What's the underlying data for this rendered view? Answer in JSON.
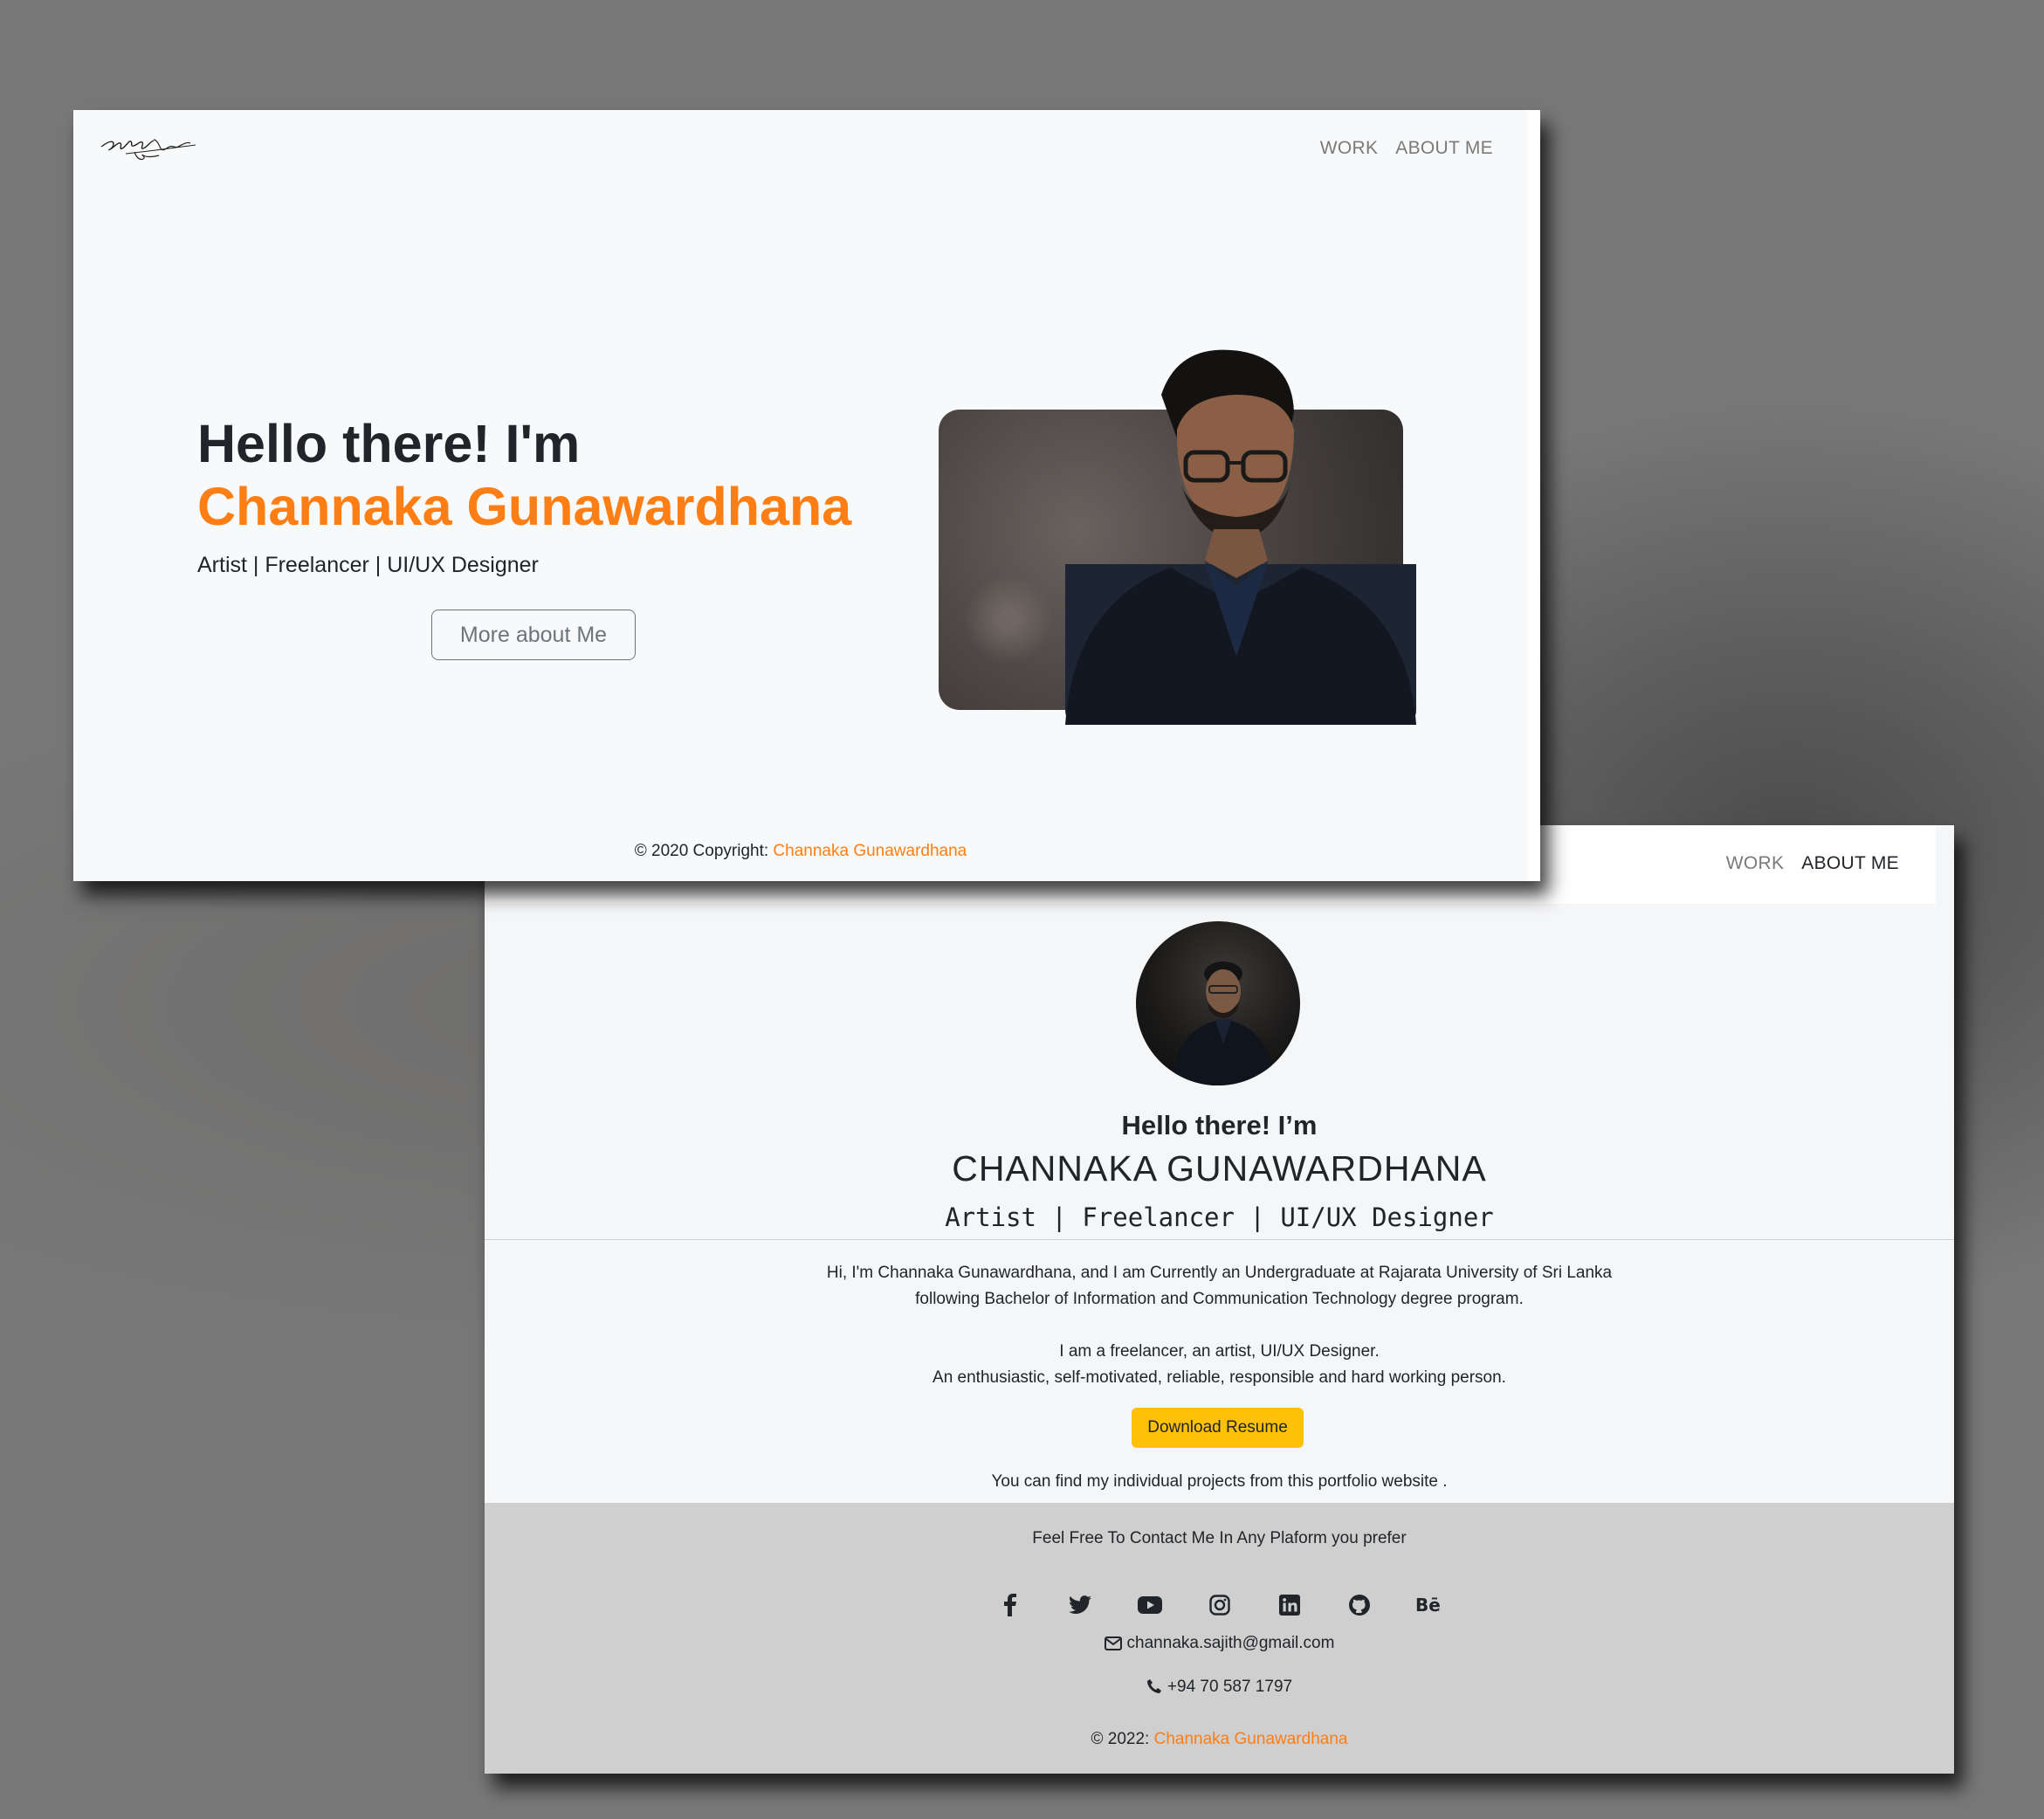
{
  "home": {
    "nav": {
      "items": [
        "WORK",
        "ABOUT ME"
      ]
    },
    "hero": {
      "greeting": "Hello there! I'm",
      "name": "Channaka Gunawardhana",
      "roles": "Artist | Freelancer | UI/UX Designer",
      "button": "More about Me"
    },
    "footer": {
      "prefix": "© 2020 Copyright: ",
      "name": "Channaka Gunawardhana"
    }
  },
  "about": {
    "nav": {
      "items": [
        "WORK",
        "ABOUT ME"
      ],
      "active": "ABOUT ME"
    },
    "greeting": "Hello there! I’m",
    "name": "CHANNAKA GUNAWARDHANA",
    "roles": "Artist | Freelancer | UI/UX Designer",
    "bio": {
      "line1": "Hi, I'm Channaka Gunawardhana, and I am Currently an Undergraduate at Rajarata University of Sri Lanka",
      "line2": "following Bachelor of Information and Communication Technology degree program.",
      "line3": "I am a freelancer, an artist, UI/UX Designer.",
      "line4": "An enthusiastic, self-motivated, reliable, responsible and hard working person."
    },
    "download_button": "Download Resume",
    "projects_note": "You can find my individual projects from this portfolio website .",
    "contact": {
      "heading": "Feel Free To Contact Me In Any Plaform you prefer",
      "socials": [
        "facebook-icon",
        "twitter-icon",
        "youtube-icon",
        "instagram-icon",
        "linkedin-icon",
        "github-icon",
        "behance-icon"
      ],
      "email": "channaka.sajith@gmail.com",
      "phone": "+94 70 587 1797",
      "copyright_prefix": "© 2022: ",
      "copyright_name": "Channaka Gunawardhana"
    }
  },
  "colors": {
    "accent": "#fd7e14",
    "button_yellow": "#ffc107",
    "text": "#212529",
    "muted": "#6c757d",
    "contact_bg": "#cfcfcf"
  }
}
